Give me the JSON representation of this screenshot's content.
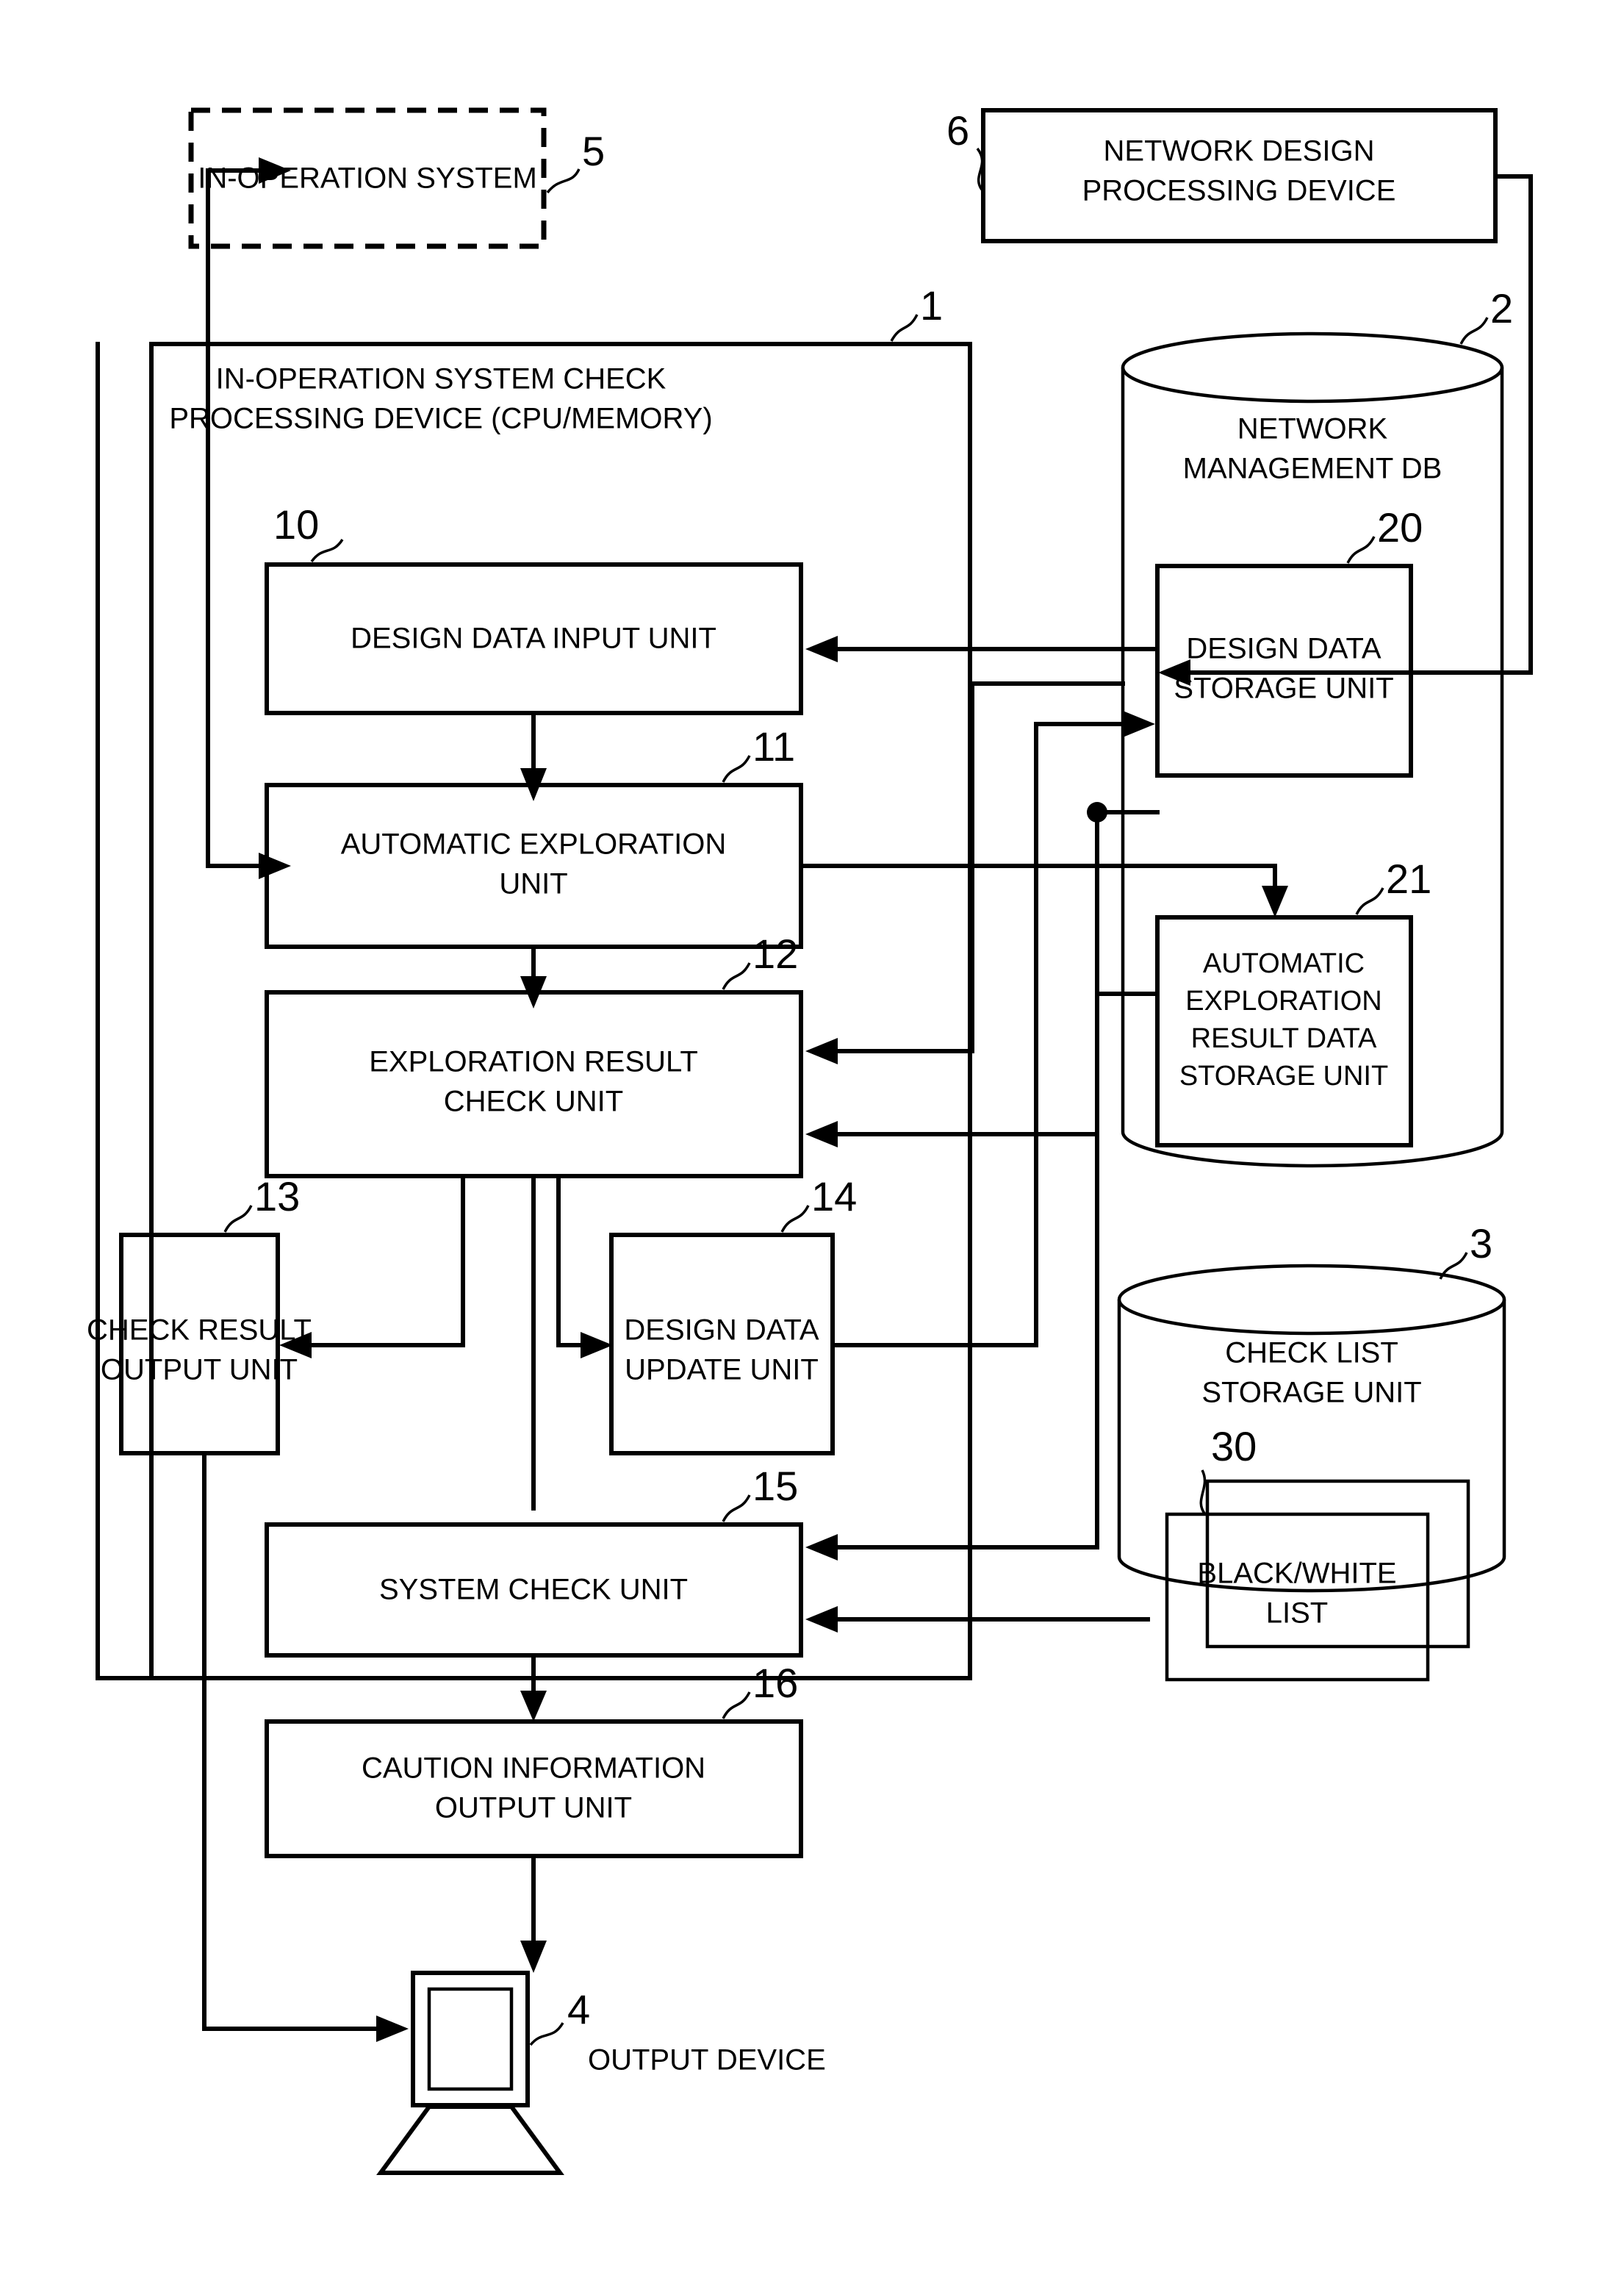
{
  "figure": {
    "type": "patent-block-diagram",
    "blocks": {
      "in_operation_system": {
        "ref": "5",
        "label": "IN-OPERATION SYSTEM",
        "style": "dashed-box"
      },
      "network_design_device": {
        "ref": "6",
        "label_line1": "NETWORK DESIGN",
        "label_line2": "PROCESSING DEVICE",
        "style": "box"
      },
      "main_device": {
        "ref": "1",
        "label_line1": "IN-OPERATION SYSTEM CHECK",
        "label_line2": "PROCESSING DEVICE (CPU/MEMORY)",
        "style": "box"
      },
      "network_management_db": {
        "ref": "2",
        "label_line1": "NETWORK",
        "label_line2": "MANAGEMENT DB",
        "style": "cylinder"
      },
      "check_list_db": {
        "ref": "3",
        "label_line1": "CHECK LIST",
        "label_line2": "STORAGE UNIT",
        "style": "cylinder"
      },
      "output_device": {
        "ref": "4",
        "label": "OUTPUT DEVICE",
        "style": "monitor"
      },
      "design_data_input_unit": {
        "ref": "10",
        "label": "DESIGN DATA INPUT UNIT",
        "style": "box"
      },
      "automatic_exploration_unit": {
        "ref": "11",
        "label_line1": "AUTOMATIC EXPLORATION",
        "label_line2": "UNIT",
        "style": "box"
      },
      "exploration_result_check_unit": {
        "ref": "12",
        "label_line1": "EXPLORATION RESULT",
        "label_line2": "CHECK UNIT",
        "style": "box"
      },
      "check_result_output_unit": {
        "ref": "13",
        "label_line1": "CHECK RESULT",
        "label_line2": "OUTPUT UNIT",
        "style": "box"
      },
      "design_data_update_unit": {
        "ref": "14",
        "label_line1": "DESIGN DATA",
        "label_line2": "UPDATE UNIT",
        "style": "box"
      },
      "system_check_unit": {
        "ref": "15",
        "label": "SYSTEM CHECK UNIT",
        "style": "box"
      },
      "caution_information_output_unit": {
        "ref": "16",
        "label_line1": "CAUTION INFORMATION",
        "label_line2": "OUTPUT UNIT",
        "style": "box"
      },
      "design_data_storage_unit": {
        "ref": "20",
        "label_line1": "DESIGN DATA",
        "label_line2": "STORAGE UNIT",
        "style": "box"
      },
      "automatic_exploration_result_data_storage_unit": {
        "ref": "21",
        "label_line1": "AUTOMATIC",
        "label_line2": "EXPLORATION",
        "label_line3": "RESULT DATA",
        "label_line4": "STORAGE UNIT",
        "style": "box"
      },
      "black_white_list": {
        "ref": "30",
        "label_line1": "BLACK/WHITE",
        "label_line2": "LIST",
        "style": "stacked-box"
      }
    },
    "reference_numerals": [
      "1",
      "2",
      "3",
      "4",
      "5",
      "6",
      "10",
      "11",
      "12",
      "13",
      "14",
      "15",
      "16",
      "20",
      "21",
      "30"
    ],
    "colors": {
      "stroke": "#000000",
      "background": "#ffffff"
    }
  }
}
